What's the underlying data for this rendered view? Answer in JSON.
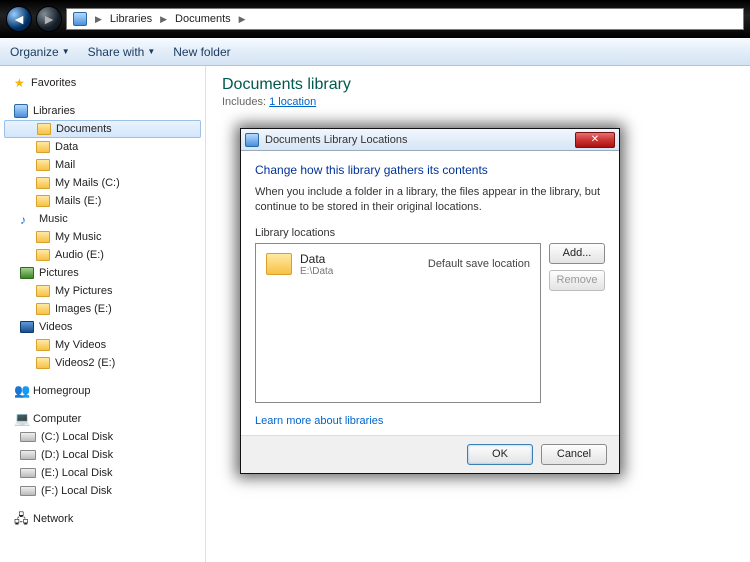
{
  "address": {
    "root": "Libraries",
    "current": "Documents"
  },
  "toolbar": {
    "organize": "Organize",
    "share": "Share with",
    "newfolder": "New folder"
  },
  "sidebar": {
    "favorites": "Favorites",
    "libraries": "Libraries",
    "documents": "Documents",
    "doc_children": [
      "Data",
      "Mail",
      "My Mails (C:)",
      "Mails (E:)"
    ],
    "music": "Music",
    "music_children": [
      "My Music",
      "Audio (E:)"
    ],
    "pictures": "Pictures",
    "pic_children": [
      "My Pictures",
      "Images (E:)"
    ],
    "videos": "Videos",
    "vid_children": [
      "My Videos",
      "Videos2 (E:)"
    ],
    "homegroup": "Homegroup",
    "computer": "Computer",
    "drives": [
      "(C:) Local Disk",
      "(D:) Local Disk",
      "(E:) Local Disk",
      "(F:) Local Disk"
    ],
    "network": "Network"
  },
  "content": {
    "title": "Documents library",
    "includes_label": "Includes:",
    "includes_link": "1 location"
  },
  "dialog": {
    "title": "Documents Library Locations",
    "heading": "Change how this library gathers its contents",
    "desc": "When you include a folder in a library, the files appear in the library, but continue to be stored in their original locations.",
    "list_label": "Library locations",
    "item_name": "Data",
    "item_path": "E:\\Data",
    "item_default": "Default save location",
    "add": "Add...",
    "remove": "Remove",
    "learn": "Learn more about libraries",
    "ok": "OK",
    "cancel": "Cancel"
  }
}
